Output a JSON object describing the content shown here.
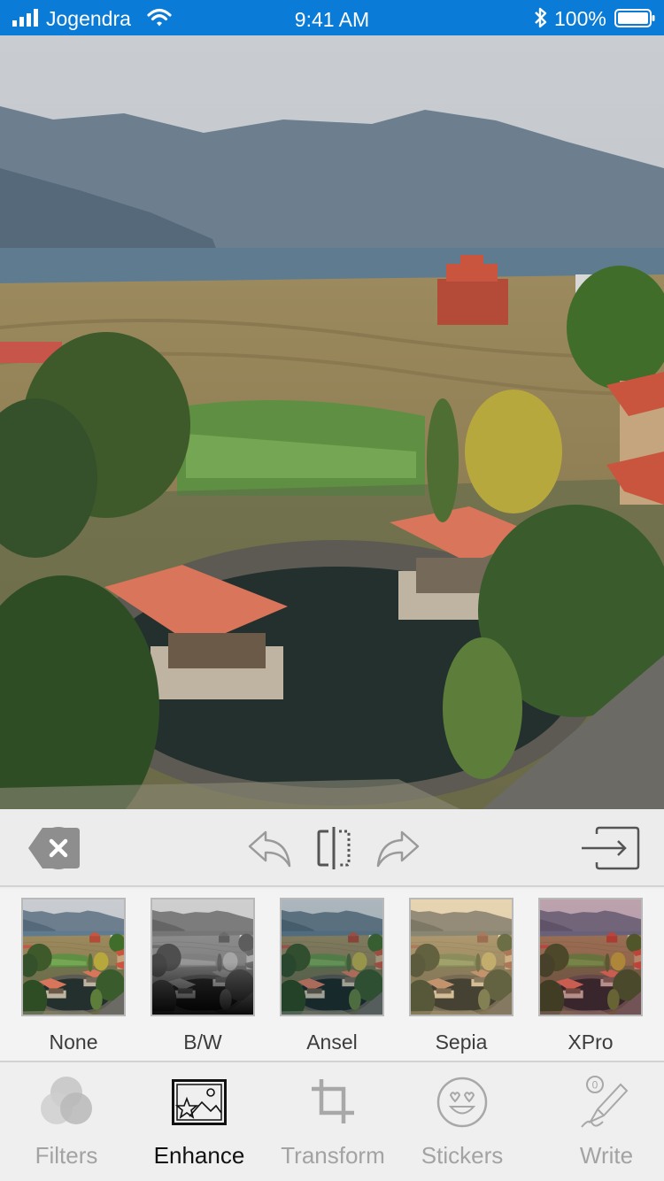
{
  "status_bar": {
    "carrier": "Jogendra",
    "time": "9:41 AM",
    "battery": "100%"
  },
  "photo": {
    "description_icon": "landscape-photo"
  },
  "toolbar": {
    "close_icon": "close-icon",
    "undo_icon": "undo-icon",
    "compare_icon": "compare-icon",
    "redo_icon": "redo-icon",
    "export_icon": "export-icon"
  },
  "filters": [
    {
      "label": "None",
      "tint": "#00000000"
    },
    {
      "label": "B/W",
      "tint": "bw"
    },
    {
      "label": "Ansel",
      "tint": "#1e4a5a"
    },
    {
      "label": "Sepia",
      "tint": "#a67a2e"
    },
    {
      "label": "XPro",
      "tint": "#8a2b45"
    }
  ],
  "tabs": [
    {
      "label": "Filters",
      "icon": "filters-icon",
      "active": false
    },
    {
      "label": "Enhance",
      "icon": "enhance-icon",
      "active": true
    },
    {
      "label": "Transform",
      "icon": "crop-icon",
      "active": false
    },
    {
      "label": "Stickers",
      "icon": "sticker-icon",
      "active": false
    },
    {
      "label": "Write",
      "icon": "write-icon",
      "active": false
    }
  ],
  "colors": {
    "status_bar": "#0a7bd6",
    "active_tab": "#111111",
    "inactive_tab": "#a3a3a3"
  }
}
